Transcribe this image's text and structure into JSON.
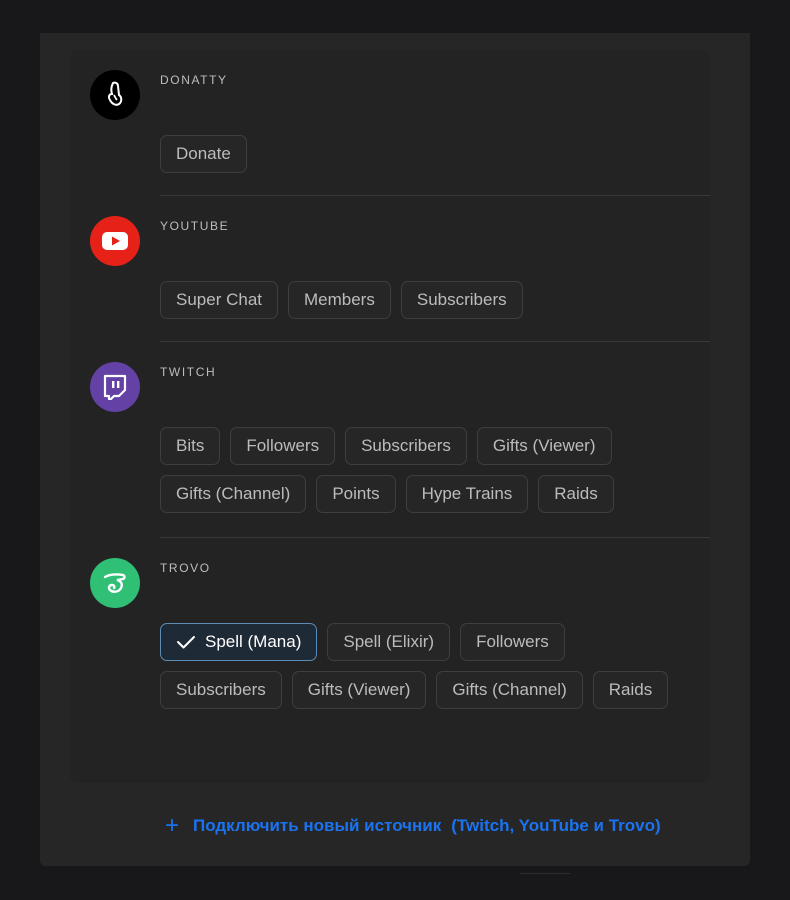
{
  "sources": [
    {
      "name": "DONATTY",
      "logo_icon": "donatty-hand-icon",
      "logo_color": "#000000",
      "events": [
        {
          "label": "Donate",
          "selected": false
        }
      ]
    },
    {
      "name": "YOUTUBE",
      "logo_icon": "youtube-play-icon",
      "logo_color": "#e62117",
      "events": [
        {
          "label": "Super Chat",
          "selected": false
        },
        {
          "label": "Members",
          "selected": false
        },
        {
          "label": "Subscribers",
          "selected": false
        }
      ]
    },
    {
      "name": "TWITCH",
      "logo_icon": "twitch-glitch-icon",
      "logo_color": "#6441a5",
      "events": [
        {
          "label": "Bits",
          "selected": false
        },
        {
          "label": "Followers",
          "selected": false
        },
        {
          "label": "Subscribers",
          "selected": false
        },
        {
          "label": "Gifts (Viewer)",
          "selected": false
        },
        {
          "label": "Gifts (Channel)",
          "selected": false
        },
        {
          "label": "Points",
          "selected": false
        },
        {
          "label": "Hype Trains",
          "selected": false
        },
        {
          "label": "Raids",
          "selected": false
        }
      ]
    },
    {
      "name": "TROVO",
      "logo_icon": "trovo-dragon-icon",
      "logo_color": "#2fbf75",
      "events": [
        {
          "label": "Spell (Mana)",
          "selected": true
        },
        {
          "label": "Spell (Elixir)",
          "selected": false
        },
        {
          "label": "Followers",
          "selected": false
        },
        {
          "label": "Subscribers",
          "selected": false
        },
        {
          "label": "Gifts (Viewer)",
          "selected": false
        },
        {
          "label": "Gifts (Channel)",
          "selected": false
        },
        {
          "label": "Raids",
          "selected": false
        }
      ]
    }
  ],
  "add_source": {
    "icon": "plus-icon",
    "label": "Подключить новый источник",
    "platforms": "(Twitch, YouTube и Trovo)",
    "color": "#1a73f0"
  },
  "colors": {
    "accent": "#1a73f0",
    "selected_border": "#5b8bb6",
    "background": "#18181a",
    "panel": "#262626"
  }
}
